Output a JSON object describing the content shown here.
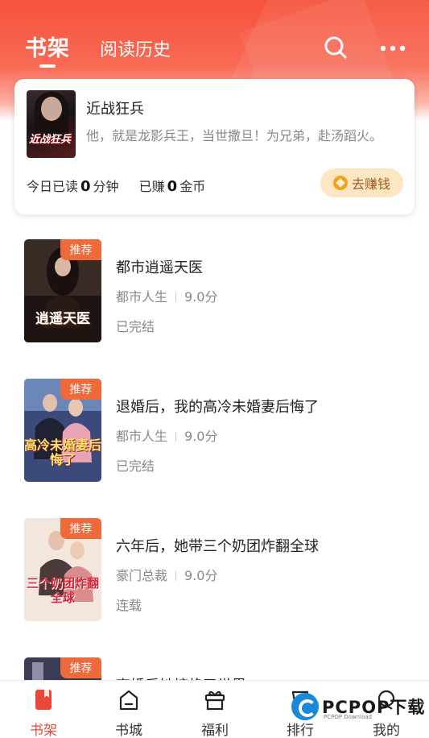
{
  "header": {
    "tab_bookshelf": "书架",
    "tab_history": "阅读历史",
    "search_icon": "search-icon",
    "more_icon": "more-dots-icon"
  },
  "current_book": {
    "title": "近战狂兵",
    "description": "他，就是龙影兵王，当世撒旦！为兄弟，赴汤蹈火。",
    "cover_text": "近战狂兵",
    "stats_read_prefix": "今日已读",
    "stats_read_value": "0",
    "stats_read_unit": "分钟",
    "stats_earned_prefix": "已赚",
    "stats_earned_value": "0",
    "stats_earned_unit": "金币",
    "earn_button": "去赚钱"
  },
  "books": [
    {
      "title": "都市逍遥天医",
      "badge": "推荐",
      "category": "都市人生",
      "score": "9.0分",
      "status": "已完结",
      "cover_text": "逍遥天医"
    },
    {
      "title": "退婚后，我的高冷未婚妻后悔了",
      "badge": "推荐",
      "category": "都市人生",
      "score": "9.0分",
      "status": "已完结",
      "cover_text": "高冷未婚妻后悔了"
    },
    {
      "title": "六年后，她带三个奶团炸翻全球",
      "badge": "推荐",
      "category": "豪门总裁",
      "score": "9.0分",
      "status": "连载",
      "cover_text": "三个奶团炸翻全球"
    },
    {
      "title": "离婚后她惊艳了世界",
      "badge": "推荐",
      "category": "",
      "score": "",
      "status": "",
      "cover_text": ""
    }
  ],
  "tabbar": [
    {
      "label": "书架",
      "icon": "bookshelf-icon",
      "active": true
    },
    {
      "label": "书城",
      "icon": "bookstore-icon",
      "active": false
    },
    {
      "label": "福利",
      "icon": "welfare-icon",
      "active": false
    },
    {
      "label": "排行",
      "icon": "ranking-icon",
      "active": false
    },
    {
      "label": "我的",
      "icon": "profile-icon",
      "active": false
    }
  ],
  "watermark": {
    "brand": "PCPOP下载",
    "sub": "PCPOP Download"
  },
  "colors": {
    "accent": "#f5523c",
    "badge": "#ef6a3a",
    "earn_bg": "#fce6c4",
    "active_tab": "#e8473a"
  }
}
